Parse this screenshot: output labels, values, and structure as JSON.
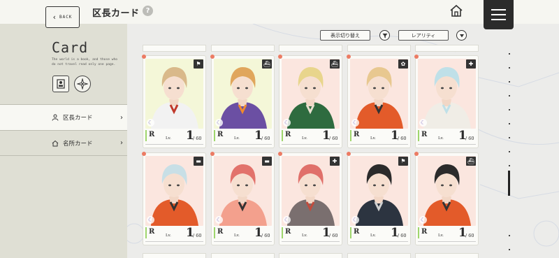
{
  "header": {
    "back_label": "BACK",
    "title": "区長カード",
    "help_glyph": "?"
  },
  "sidebar": {
    "title": "Card",
    "description": "The world is a book, and those who do not travel read only one page.",
    "nav": [
      {
        "label": "区長カード",
        "icon": "person-icon",
        "active": true
      },
      {
        "label": "名所カード",
        "icon": "home-icon",
        "active": false
      }
    ]
  },
  "toolbar": {
    "toggle_label": "表示切り替え",
    "sort_label": "レアリティ"
  },
  "cards": [
    {
      "rarity": "R",
      "lv_label": "Lv.",
      "level": "1",
      "max": "/ 60",
      "attr_icon": "flag-icon",
      "bg": "#f4f7d8",
      "hair": "#d9b98a",
      "outfit": "#f2f2f2",
      "accent": "#c0392b"
    },
    {
      "rarity": "R",
      "lv_label": "Lv.",
      "level": "1",
      "max": "/ 60",
      "attr_icon": "ship-icon",
      "bg": "#f4f7d8",
      "hair": "#e0a65c",
      "outfit": "#6b4fa3",
      "accent": "#f08a2c"
    },
    {
      "rarity": "R",
      "lv_label": "Lv.",
      "level": "1",
      "max": "/ 60",
      "attr_icon": "ship-icon",
      "bg": "#fbe6df",
      "hair": "#e8d58c",
      "outfit": "#2e6b3f",
      "accent": "#e8e0d0"
    },
    {
      "rarity": "R",
      "lv_label": "Lv.",
      "level": "1",
      "max": "/ 60",
      "attr_icon": "leaf-icon",
      "bg": "#fbe6df",
      "hair": "#e8c890",
      "outfit": "#e35b2a",
      "accent": "#333333"
    },
    {
      "rarity": "R",
      "lv_label": "Lv.",
      "level": "1",
      "max": "/ 60",
      "attr_icon": "medic-icon",
      "bg": "#fbe6df",
      "hair": "#bfe0e8",
      "outfit": "#f0ede6",
      "accent": "#bfe0e8"
    },
    {
      "rarity": "R",
      "lv_label": "Lv.",
      "level": "1",
      "max": "/ 60",
      "attr_icon": "gun-icon",
      "bg": "#fbe6df",
      "hair": "#c8dfe6",
      "outfit": "#e35b2a",
      "accent": "#333333"
    },
    {
      "rarity": "R",
      "lv_label": "Lv.",
      "level": "1",
      "max": "/ 60",
      "attr_icon": "gun-icon",
      "bg": "#fbe6df",
      "hair": "#e2726b",
      "outfit": "#f3a08d",
      "accent": "#333333"
    },
    {
      "rarity": "R",
      "lv_label": "Lv.",
      "level": "1",
      "max": "/ 60",
      "attr_icon": "medic-icon",
      "bg": "#fbe6df",
      "hair": "#e0706a",
      "outfit": "#7a6f6f",
      "accent": "#c24b3c"
    },
    {
      "rarity": "R",
      "lv_label": "Lv.",
      "level": "1",
      "max": "/ 60",
      "attr_icon": "flag-icon",
      "bg": "#fbe6df",
      "hair": "#2b2b2b",
      "outfit": "#2c3440",
      "accent": "#d0d0d0"
    },
    {
      "rarity": "R",
      "lv_label": "Lv.",
      "level": "1",
      "max": "/ 60",
      "attr_icon": "ship-icon",
      "bg": "#fbe6df",
      "hair": "#2b2b2b",
      "outfit": "#e35b2a",
      "accent": "#333333"
    }
  ],
  "colors": {
    "accent_dot": "#ec7b63",
    "rarity_bar": "#9fd66d",
    "menu_bg": "#2b2b2b"
  }
}
